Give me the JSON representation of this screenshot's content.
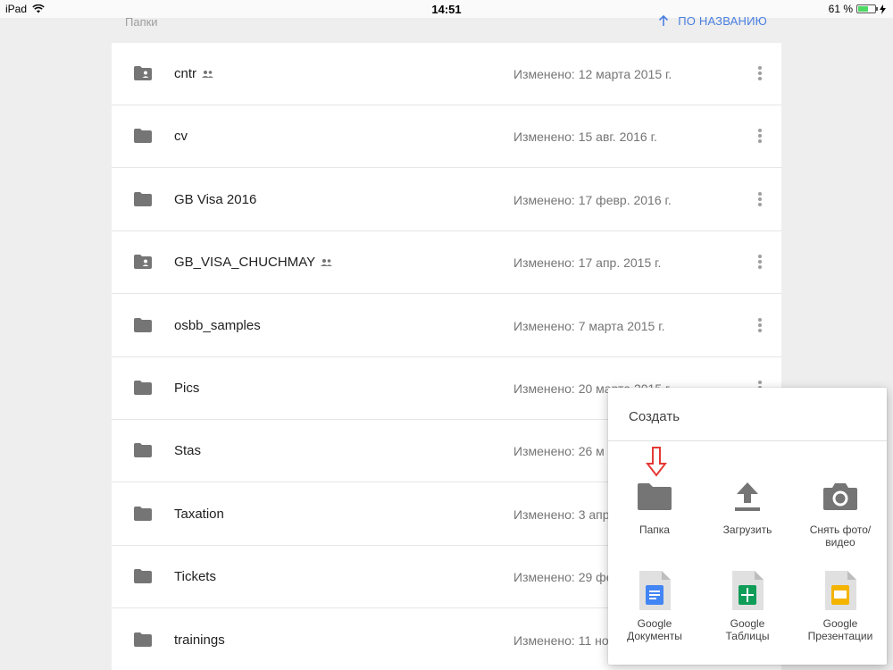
{
  "status_bar": {
    "device": "iPad",
    "time": "14:51",
    "battery": "61 %",
    "battery_level": 0.61
  },
  "section": {
    "title": "Папки",
    "sort_label": "ПО НАЗВАНИЮ"
  },
  "folders": [
    {
      "name": "cntr",
      "date": "Изменено: 12 марта 2015 г.",
      "shared": true
    },
    {
      "name": "cv",
      "date": "Изменено: 15 авг. 2016 г.",
      "shared": false
    },
    {
      "name": "GB Visa 2016",
      "date": "Изменено: 17 февр. 2016 г.",
      "shared": false
    },
    {
      "name": "GB_VISA_CHUCHMAY",
      "date": "Изменено: 17 апр. 2015 г.",
      "shared": true
    },
    {
      "name": "osbb_samples",
      "date": "Изменено: 7 марта 2015 г.",
      "shared": false
    },
    {
      "name": "Pics",
      "date": "Изменено: 20 марта 2015 г.",
      "shared": false
    },
    {
      "name": "Stas",
      "date": "Изменено: 26 м",
      "shared": false
    },
    {
      "name": "Taxation",
      "date": "Изменено: 3 апр",
      "shared": false
    },
    {
      "name": "Tickets",
      "date": "Изменено: 29 фе",
      "shared": false
    },
    {
      "name": "trainings",
      "date": "Изменено: 11 но",
      "shared": false
    }
  ],
  "create_menu": {
    "title": "Создать",
    "folder": "Папка",
    "upload": "Загрузить",
    "camera_line1": "Снять фото/",
    "camera_line2": "видео",
    "docs_line1": "Google",
    "docs_line2": "Документы",
    "sheets_line1": "Google",
    "sheets_line2": "Таблицы",
    "slides_line1": "Google",
    "slides_line2": "Презентации"
  },
  "colors": {
    "accent": "#4a7fe0",
    "folder": "#757575",
    "docs": "#4285f4",
    "sheets": "#0f9d58",
    "slides": "#f4b400",
    "arrow": "#e53935"
  }
}
